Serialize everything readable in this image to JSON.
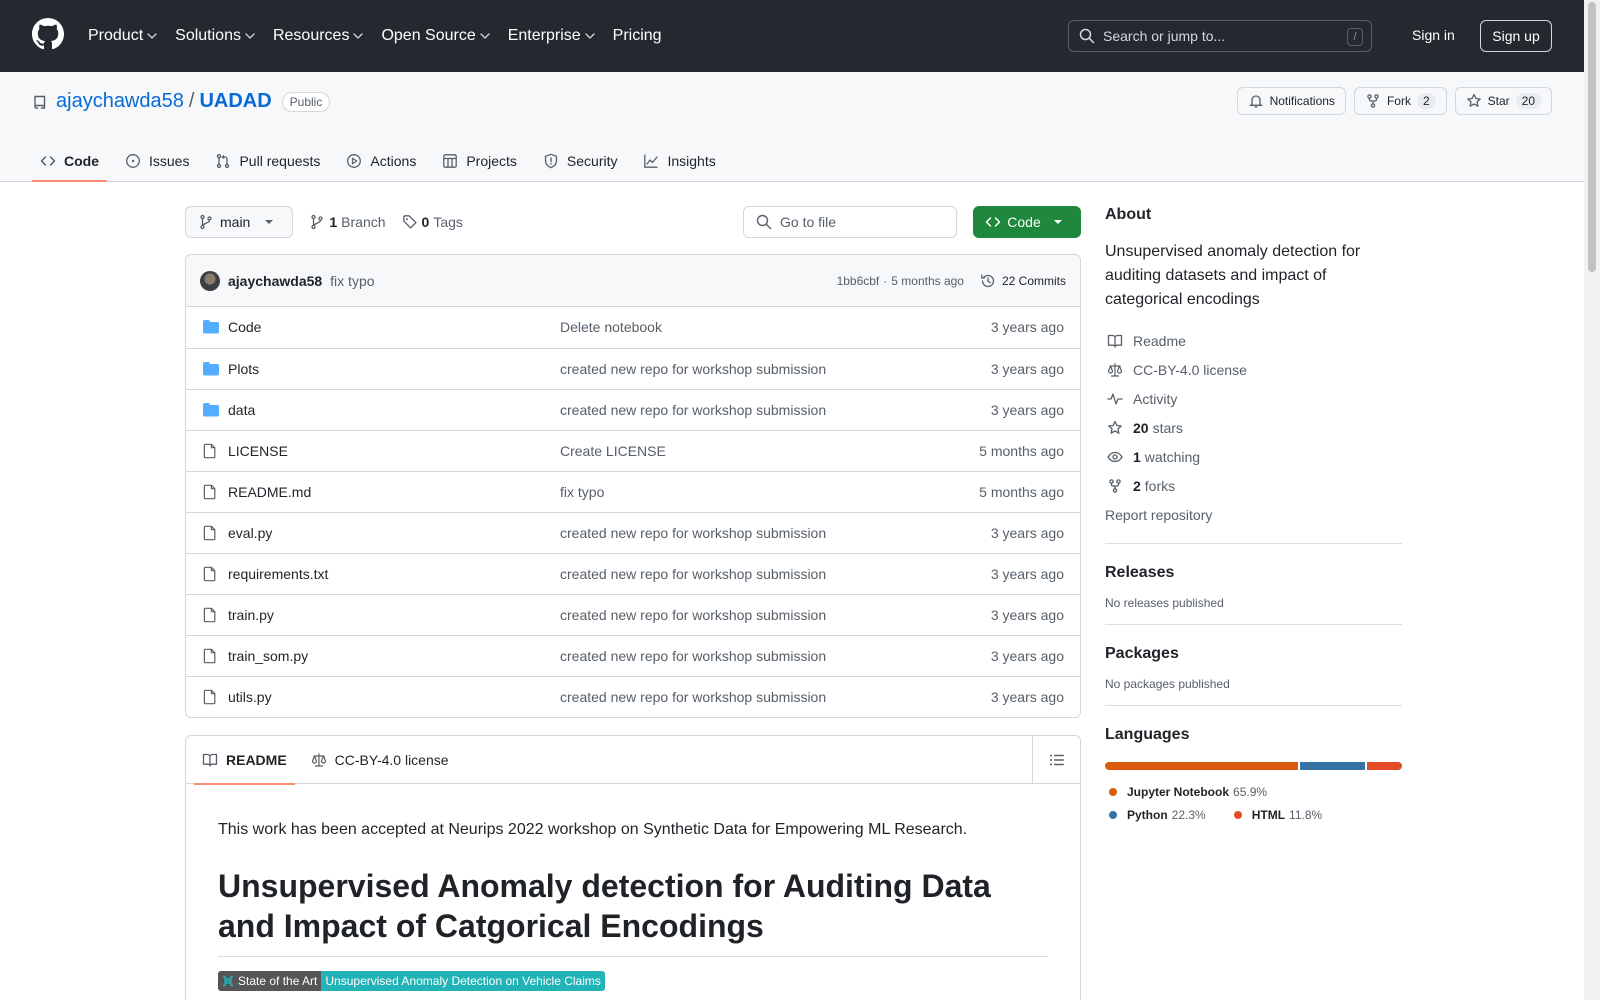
{
  "header": {
    "nav": [
      {
        "label": "Product",
        "chevron": true
      },
      {
        "label": "Solutions",
        "chevron": true
      },
      {
        "label": "Resources",
        "chevron": true
      },
      {
        "label": "Open Source",
        "chevron": true
      },
      {
        "label": "Enterprise",
        "chevron": true
      },
      {
        "label": "Pricing",
        "chevron": false
      }
    ],
    "search_placeholder": "Search or jump to...",
    "search_shortcut": "/",
    "signin": "Sign in",
    "signup": "Sign up"
  },
  "repo": {
    "owner": "ajaychawda58",
    "separator": "/",
    "name": "UADAD",
    "visibility": "Public",
    "notifications": "Notifications",
    "fork_label": "Fork",
    "fork_count": "2",
    "star_label": "Star",
    "star_count": "20"
  },
  "tabs": [
    {
      "label": "Code",
      "icon": "code-icon",
      "active": true
    },
    {
      "label": "Issues",
      "icon": "issue-icon",
      "active": false
    },
    {
      "label": "Pull requests",
      "icon": "pull-request-icon",
      "active": false
    },
    {
      "label": "Actions",
      "icon": "play-icon",
      "active": false
    },
    {
      "label": "Projects",
      "icon": "table-icon",
      "active": false
    },
    {
      "label": "Security",
      "icon": "shield-icon",
      "active": false
    },
    {
      "label": "Insights",
      "icon": "graph-icon",
      "active": false
    }
  ],
  "toolbar": {
    "branch": "main",
    "branch_count": "1",
    "branch_label": "Branch",
    "tag_count": "0",
    "tag_label": "Tags",
    "goto_placeholder": "Go to file",
    "code_button": "Code"
  },
  "commit": {
    "author": "ajaychawda58",
    "message": "fix typo",
    "hash": "1bb6cbf",
    "dot": "·",
    "time": "5 months ago",
    "commits_label": "22 Commits"
  },
  "files": [
    {
      "type": "folder",
      "name": "Code",
      "message": "Delete notebook",
      "date": "3 years ago"
    },
    {
      "type": "folder",
      "name": "Plots",
      "message": "created new repo for workshop submission",
      "date": "3 years ago"
    },
    {
      "type": "folder",
      "name": "data",
      "message": "created new repo for workshop submission",
      "date": "3 years ago"
    },
    {
      "type": "file",
      "name": "LICENSE",
      "message": "Create LICENSE",
      "date": "5 months ago"
    },
    {
      "type": "file",
      "name": "README.md",
      "message": "fix typo",
      "date": "5 months ago"
    },
    {
      "type": "file",
      "name": "eval.py",
      "message": "created new repo for workshop submission",
      "date": "3 years ago"
    },
    {
      "type": "file",
      "name": "requirements.txt",
      "message": "created new repo for workshop submission",
      "date": "3 years ago"
    },
    {
      "type": "file",
      "name": "train.py",
      "message": "created new repo for workshop submission",
      "date": "3 years ago"
    },
    {
      "type": "file",
      "name": "train_som.py",
      "message": "created new repo for workshop submission",
      "date": "3 years ago"
    },
    {
      "type": "file",
      "name": "utils.py",
      "message": "created new repo for workshop submission",
      "date": "3 years ago"
    }
  ],
  "readme": {
    "tab_readme": "README",
    "tab_license": "CC-BY-4.0 license",
    "intro": "This work has been accepted at Neurips 2022 workshop on Synthetic Data for Empowering ML Research.",
    "heading": "Unsupervised Anomaly detection for Auditing Data and Impact of Catgorical Encodings",
    "badge_left": "State of the Art",
    "badge_right": "Unsupervised Anomaly Detection on Vehicle Claims"
  },
  "about": {
    "title": "About",
    "description": "Unsupervised anomaly detection for auditing datasets and impact of categorical encodings",
    "readme": "Readme",
    "license": "CC-BY-4.0 license",
    "activity": "Activity",
    "stars_count": "20",
    "stars_label": "stars",
    "watching_count": "1",
    "watching_label": "watching",
    "forks_count": "2",
    "forks_label": "forks",
    "report": "Report repository"
  },
  "releases": {
    "title": "Releases",
    "empty": "No releases published"
  },
  "packages": {
    "title": "Packages",
    "empty": "No packages published"
  },
  "languages": {
    "title": "Languages",
    "items": [
      {
        "name": "Jupyter Notebook",
        "percent": "65.9%",
        "value": 65.9,
        "color": "#DA5B0B"
      },
      {
        "name": "Python",
        "percent": "22.3%",
        "value": 22.3,
        "color": "#3572A5"
      },
      {
        "name": "HTML",
        "percent": "11.8%",
        "value": 11.8,
        "color": "#E34C26"
      }
    ]
  }
}
